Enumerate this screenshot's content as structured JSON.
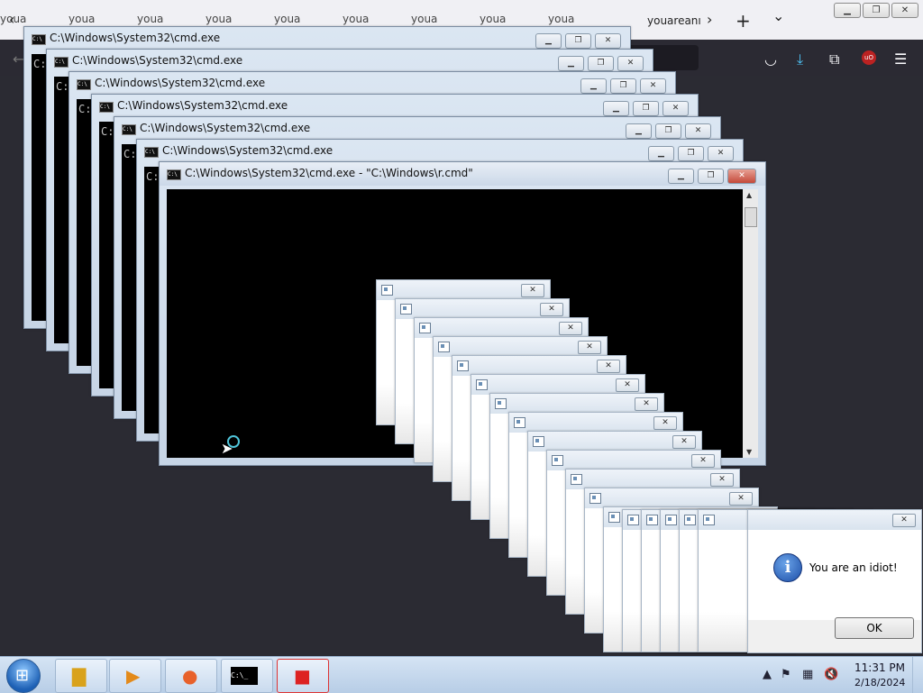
{
  "browser": {
    "background_tabs": [
      "youa",
      "youa",
      "youa",
      "youa",
      "youa",
      "youa",
      "youa",
      "youa",
      "youa"
    ],
    "active_tab_label": "youareanı",
    "back_icon": "‹",
    "forward_icon": "›",
    "new_tab_icon": "+",
    "tab_list_icon": "⌄",
    "toolbar_icons": [
      "pocket",
      "download",
      "extensions",
      "ublock",
      "menu"
    ]
  },
  "cmd_windows": {
    "title": "C:\\Windows\\System32\\cmd.exe",
    "front_title": "C:\\Windows\\System32\\cmd.exe - \"C:\\Windows\\r.cmd\"",
    "prompt": "C:",
    "minimize": "▁",
    "maximize": "❐",
    "close": "✕"
  },
  "message_box": {
    "text": "You are an idiot!",
    "ok_label": "OK",
    "icon_letter": "i",
    "close": "✕"
  },
  "taskbar": {
    "time": "11:31 PM",
    "date": "2/18/2024",
    "apps": [
      "explorer",
      "media-player",
      "firefox",
      "cmd",
      "app"
    ]
  },
  "colors": {
    "desktop_bg": "#2b2b33",
    "close_red": "#c4493a",
    "taskbar": "#c9daee"
  }
}
